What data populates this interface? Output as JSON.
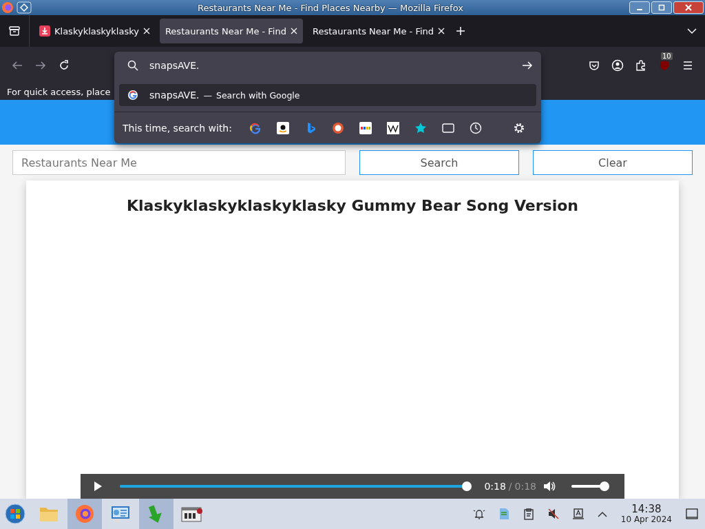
{
  "window": {
    "title": "Restaurants Near Me - Find Places Nearby — Mozilla Firefox"
  },
  "tabs": [
    {
      "label": "Klaskyklaskyklasky",
      "selected": false,
      "kind": "media"
    },
    {
      "label": "Restaurants Near Me - Find",
      "selected": true,
      "kind": "plain"
    },
    {
      "label": "Restaurants Near Me - Find",
      "selected": false,
      "kind": "plain"
    }
  ],
  "toolbar": {
    "extension_badge": "10"
  },
  "bookmarks_bar": {
    "text": "For quick access, place"
  },
  "address_dropdown": {
    "value": "snapsAVE.",
    "suggestion": {
      "query": "snapsAVE.",
      "separator": "—",
      "action": "Search with Google"
    },
    "search_with_label": "This time, search with:"
  },
  "page": {
    "search": {
      "placeholder": "Restaurants Near Me"
    },
    "buttons": [
      "Search",
      "Clear"
    ],
    "card_title": "Klaskyklaskyklaskyklasky Gummy Bear Song Version",
    "player": {
      "current": "0:18",
      "separator": "/",
      "duration": "0:18",
      "progress": {
        "level": 1
      },
      "volume": {
        "level": 1
      }
    }
  },
  "taskbar": {
    "apps": [
      {
        "kind": "files",
        "selected": false
      },
      {
        "kind": "browser",
        "selected": true
      },
      {
        "kind": "settings",
        "selected": false
      },
      {
        "kind": "download",
        "selected": true
      },
      {
        "kind": "tool",
        "selected": false
      }
    ],
    "clock": {
      "time": "14:38",
      "date": "10 Apr 2024"
    }
  }
}
